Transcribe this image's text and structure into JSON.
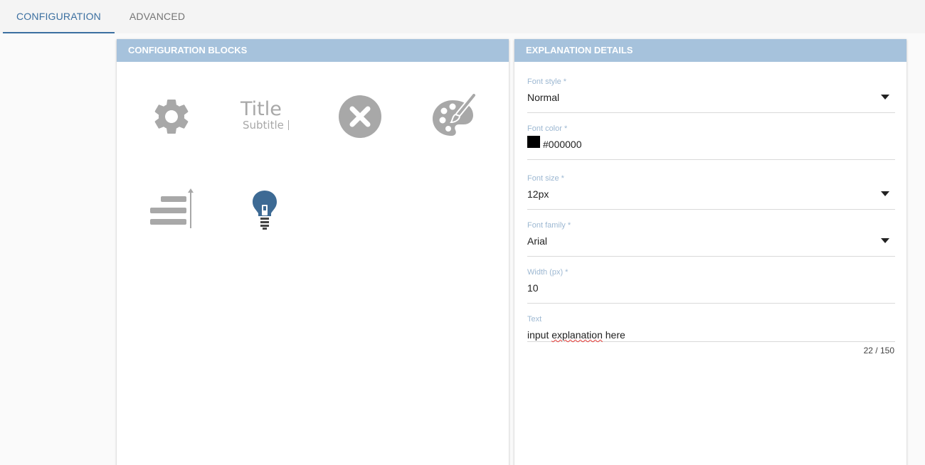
{
  "tabs": [
    {
      "label": "CONFIGURATION",
      "active": true
    },
    {
      "label": "ADVANCED",
      "active": false
    }
  ],
  "left_panel": {
    "header": "CONFIGURATION BLOCKS",
    "blocks": [
      {
        "icon": "gear-icon"
      },
      {
        "icon": "title-subtitle-icon",
        "title_text": "Title",
        "subtitle_text": "Subtitle"
      },
      {
        "icon": "close-circle-icon"
      },
      {
        "icon": "palette-brush-icon"
      },
      {
        "icon": "align-lines-arrow-icon"
      },
      {
        "icon": "lightbulb-icon"
      }
    ]
  },
  "right_panel": {
    "header": "EXPLANATION DETAILS",
    "fields": {
      "font_style": {
        "label": "Font style *",
        "value": "Normal"
      },
      "font_color": {
        "label": "Font color *",
        "value": "#000000"
      },
      "font_size": {
        "label": "Font size *",
        "value": "12px"
      },
      "font_family": {
        "label": "Font family *",
        "value": "Arial"
      },
      "width": {
        "label": "Width (px) *",
        "value": "10"
      },
      "text": {
        "label": "Text",
        "value_prefix": "input ",
        "value_misspelled": "explanation",
        "value_suffix": " here",
        "counter": "22 / 150"
      }
    }
  },
  "colors": {
    "accent": "#3b6fa0",
    "header_bg": "#a6c2dc",
    "label": "#9db8d2",
    "icon_gray": "#a8a8a8",
    "bulb_blue": "#3d6a94"
  }
}
